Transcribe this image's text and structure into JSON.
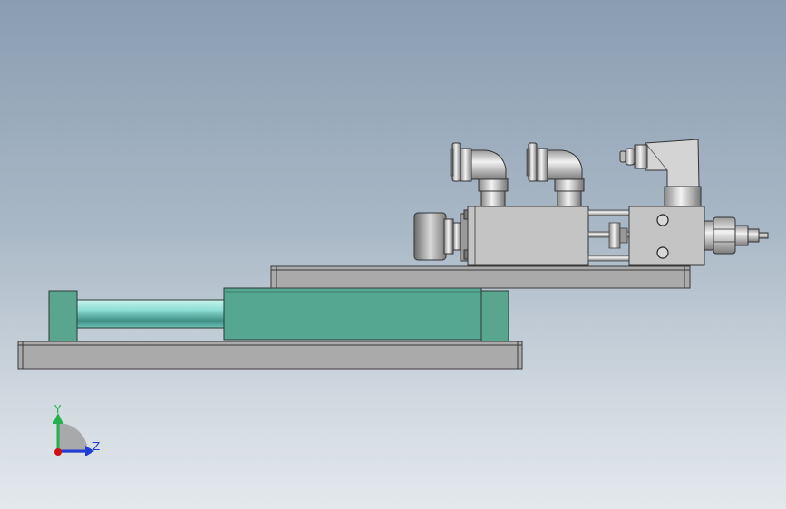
{
  "viewport": {
    "background_top": "#8a9db1",
    "background_bottom": "#e3e8ec"
  },
  "model": {
    "colors": {
      "plate": "#aaaaaa",
      "plate_edge": "#3a3a3a",
      "cylinder_body": "#56a791",
      "cylinder_end": "#5aa58e",
      "piston_rod": "#8fe0d6",
      "metal": "#c8c8c8",
      "metal_dark": "#8c8c8c"
    }
  },
  "triad": {
    "y_label": "Y",
    "z_label": "Z",
    "y_color": "#22b14c",
    "z_color": "#1f3fd8",
    "origin_color": "#d01010"
  }
}
